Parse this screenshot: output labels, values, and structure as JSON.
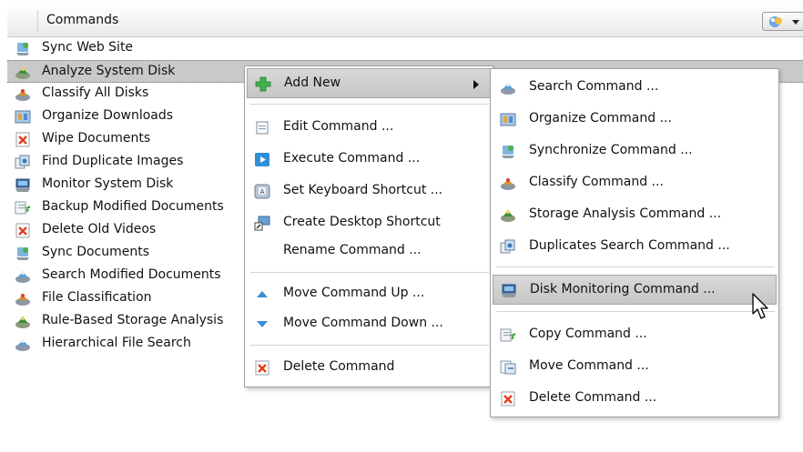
{
  "header": {
    "column_title": "Commands",
    "view_button_icon": "view-options-icon"
  },
  "list": {
    "items": [
      {
        "label": "Sync Web Site",
        "icon": "sync-icon"
      },
      {
        "label": "Analyze System Disk",
        "icon": "storage-analysis-icon",
        "selected": true
      },
      {
        "label": "Classify All Disks",
        "icon": "classify-icon"
      },
      {
        "label": "Organize Downloads",
        "icon": "organize-icon"
      },
      {
        "label": "Wipe Documents",
        "icon": "delete-icon"
      },
      {
        "label": "Find Duplicate Images",
        "icon": "duplicates-icon"
      },
      {
        "label": "Monitor System Disk",
        "icon": "monitor-icon"
      },
      {
        "label": "Backup Modified Documents",
        "icon": "copy-icon"
      },
      {
        "label": "Delete Old Videos",
        "icon": "delete-icon"
      },
      {
        "label": "Sync Documents",
        "icon": "sync-icon"
      },
      {
        "label": "Search Modified Documents",
        "icon": "search-icon"
      },
      {
        "label": "File Classification",
        "icon": "classify-icon"
      },
      {
        "label": "Rule-Based Storage Analysis",
        "icon": "storage-analysis-icon"
      },
      {
        "label": "Hierarchical File Search",
        "icon": "search-icon"
      }
    ]
  },
  "context_menu": {
    "items": [
      {
        "label": "Add New",
        "icon": "add-icon",
        "highlighted": true,
        "submenu": true
      },
      {
        "label": "Edit Command ...",
        "icon": "edit-icon"
      },
      {
        "label": "Execute Command ...",
        "icon": "play-icon"
      },
      {
        "label": "Set Keyboard Shortcut ...",
        "icon": "keyboard-icon"
      },
      {
        "label": "Create Desktop Shortcut",
        "icon": "desktop-shortcut-icon"
      },
      {
        "label": "Rename Command ...",
        "icon": ""
      },
      {
        "label": "Move Command Up ...",
        "icon": "triangle-up-icon"
      },
      {
        "label": "Move Command Down ...",
        "icon": "triangle-down-icon"
      },
      {
        "label": "Delete Command",
        "icon": "delete-icon"
      }
    ]
  },
  "submenu": {
    "items": [
      {
        "label": "Search Command ...",
        "icon": "search-icon"
      },
      {
        "label": "Organize Command ...",
        "icon": "organize-icon"
      },
      {
        "label": "Synchronize Command ...",
        "icon": "sync-icon"
      },
      {
        "label": "Classify Command ...",
        "icon": "classify-icon"
      },
      {
        "label": "Storage Analysis Command ...",
        "icon": "storage-analysis-icon"
      },
      {
        "label": "Duplicates Search Command ...",
        "icon": "duplicates-icon"
      },
      {
        "label": "Disk Monitoring Command ...",
        "icon": "monitor-icon",
        "highlighted": true
      },
      {
        "label": "Copy Command ...",
        "icon": "copy-icon"
      },
      {
        "label": "Move Command ...",
        "icon": "move-icon"
      },
      {
        "label": "Delete Command ...",
        "icon": "delete-icon"
      }
    ]
  },
  "colors": {
    "selection": "#c9c9c9",
    "menu_highlight": "#cfcfcf",
    "move_arrow": "#3a8fd8",
    "add_green": "#2ea83a",
    "delete_red": "#e0401c"
  }
}
